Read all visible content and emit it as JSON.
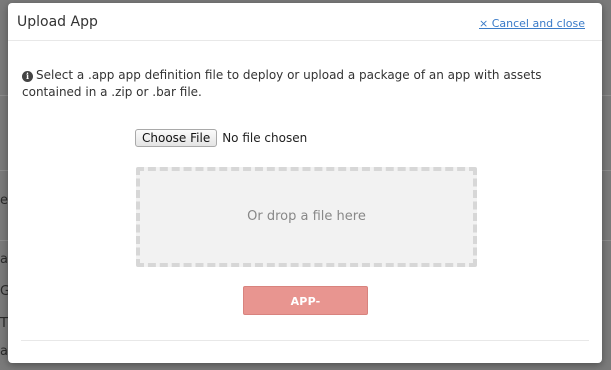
{
  "modal": {
    "title": "Upload App",
    "close_label": "× Cancel and close",
    "info_text": "Select a .app app definition file to deploy or upload a package of an app with assets contained in a .zip or .bar file.",
    "info_icon": "info-circle-icon",
    "file_input": {
      "button_label": "Choose File",
      "status": "No file chosen"
    },
    "drop_zone_text": "Or drop a file here",
    "submit_label": "APP-DEPLOYMENTS"
  },
  "background_fragments": [
    "e",
    "a",
    "G",
    "T",
    "a"
  ],
  "colors": {
    "link": "#3a7bc8",
    "submit_button": "#e89590",
    "drop_zone_border": "#d7d7d7",
    "overlay": "#7a7a7a"
  }
}
